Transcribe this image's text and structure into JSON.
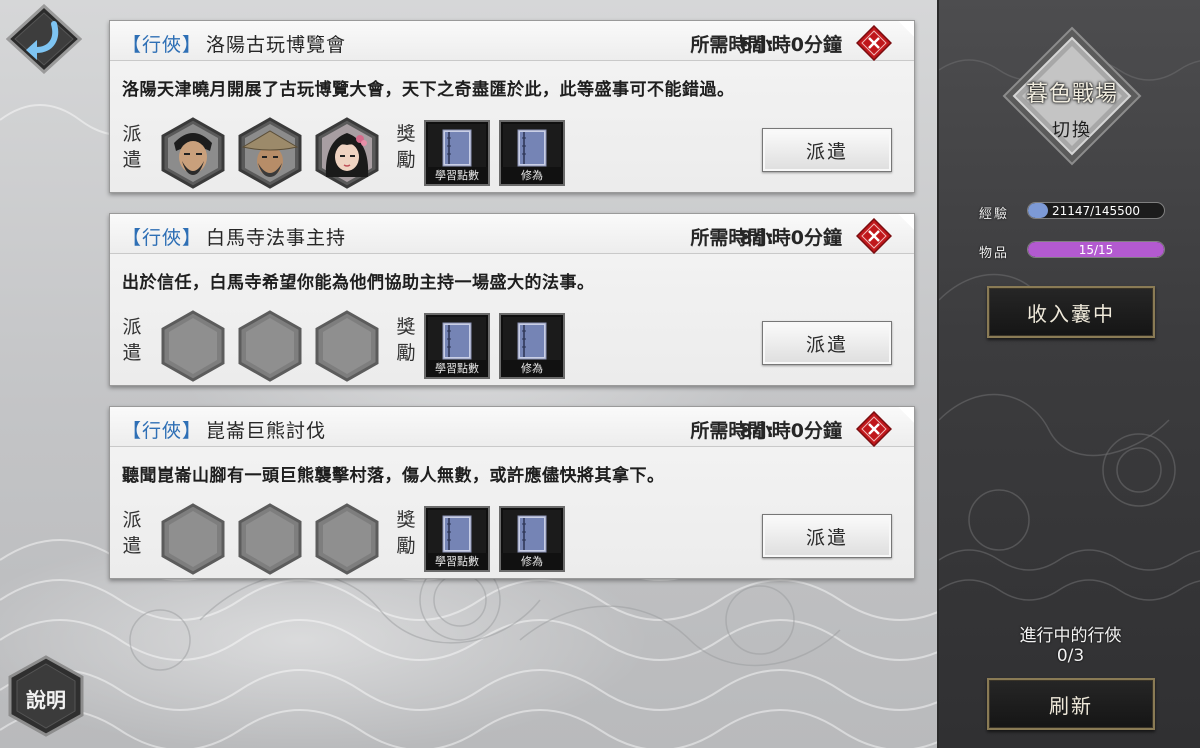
{
  "quests": [
    {
      "tag": "【行俠】",
      "title": "洛陽古玩博覽會",
      "time_label": "所需時間:",
      "time_value": "6小時0分鐘",
      "description": "洛陽天津曉月開展了古玩博覽大會，天下之奇盡匯於此，此等盛事可不能錯過。",
      "dispatch_label": "派遣",
      "reward_label": "獎勵",
      "slots": [
        "bearded-swordsman-portrait",
        "straw-hat-elder-portrait",
        "female-hero-portrait"
      ],
      "rewards": [
        "學習點數",
        "修為"
      ],
      "button": "派遣"
    },
    {
      "tag": "【行俠】",
      "title": "白馬寺法事主持",
      "time_label": "所需時間:",
      "time_value": "8小時0分鐘",
      "description": "出於信任，白馬寺希望你能為他們協助主持一場盛大的法事。",
      "dispatch_label": "派遣",
      "reward_label": "獎勵",
      "slots": [
        "empty",
        "empty",
        "empty"
      ],
      "rewards": [
        "學習點數",
        "修為"
      ],
      "button": "派遣"
    },
    {
      "tag": "【行俠】",
      "title": "崑崙巨熊討伐",
      "time_label": "所需時間:",
      "time_value": "8小時0分鐘",
      "description": "聽聞崑崙山腳有一頭巨熊襲擊村落，傷人無數，或許應儘快將其拿下。",
      "dispatch_label": "派遣",
      "reward_label": "獎勵",
      "slots": [
        "empty",
        "empty",
        "empty"
      ],
      "rewards": [
        "學習點數",
        "修為"
      ],
      "button": "派遣"
    }
  ],
  "side": {
    "mode_title": "暮色戰場",
    "mode_sub": "切換",
    "exp_label": "經驗",
    "exp_text": "21147/145500",
    "exp_fraction": 0.145,
    "items_label": "物品",
    "items_text": "15/15",
    "items_fraction": 1.0,
    "collect_button": "收入囊中",
    "progress_label": "進行中的行俠",
    "progress_value": "0/3",
    "refresh_button": "刷新"
  },
  "help_label": "說明",
  "colors": {
    "tag_blue": "#2e6fb5",
    "close_red": "#c0171b",
    "exp_bar": "#7d9ad6",
    "items_bar": "#b35ad0"
  },
  "icons": {
    "back": "curved-arrow-back-icon",
    "close": "red-diamond-x-icon",
    "reward": "book-icon"
  }
}
